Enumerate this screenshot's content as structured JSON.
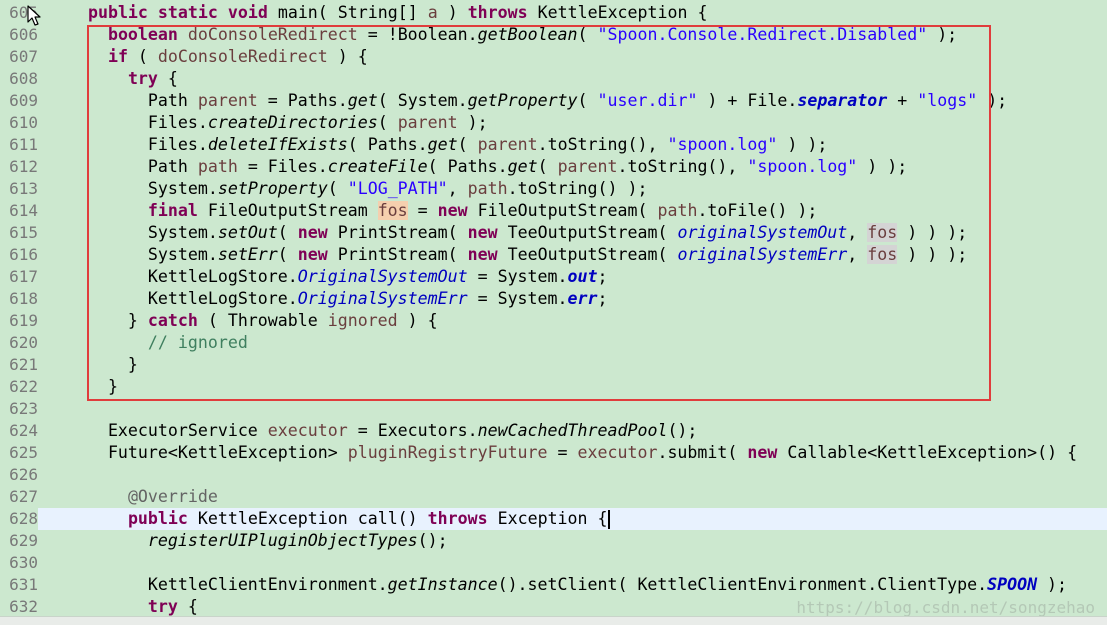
{
  "editor": {
    "lines": [
      {
        "n": "605",
        "tokens": [
          [
            "    ",
            ""
          ],
          [
            "public",
            "kw"
          ],
          [
            " ",
            ""
          ],
          [
            "static",
            "kw"
          ],
          [
            " ",
            ""
          ],
          [
            "void",
            "kw"
          ],
          [
            " main( String[] ",
            ""
          ],
          [
            "a",
            "var"
          ],
          [
            " ) ",
            ""
          ],
          [
            "throws",
            "kw"
          ],
          [
            " KettleException {",
            ""
          ]
        ]
      },
      {
        "n": "606",
        "tokens": [
          [
            "      ",
            ""
          ],
          [
            "boolean",
            "kw"
          ],
          [
            " ",
            ""
          ],
          [
            "doConsoleRedirect",
            "var"
          ],
          [
            " = !Boolean.",
            ""
          ],
          [
            "getBoolean",
            "it"
          ],
          [
            "( ",
            ""
          ],
          [
            "\"Spoon.Console.Redirect.Disabled\"",
            "str"
          ],
          [
            " );",
            ""
          ]
        ]
      },
      {
        "n": "607",
        "tokens": [
          [
            "      ",
            ""
          ],
          [
            "if",
            "kw"
          ],
          [
            " ( ",
            ""
          ],
          [
            "doConsoleRedirect",
            "var"
          ],
          [
            " ) {",
            ""
          ]
        ]
      },
      {
        "n": "608",
        "tokens": [
          [
            "        ",
            ""
          ],
          [
            "try",
            "kw"
          ],
          [
            " {",
            ""
          ]
        ]
      },
      {
        "n": "609",
        "tokens": [
          [
            "          Path ",
            ""
          ],
          [
            "parent",
            "var"
          ],
          [
            " = Paths.",
            ""
          ],
          [
            "get",
            "it"
          ],
          [
            "( System.",
            ""
          ],
          [
            "getProperty",
            "it"
          ],
          [
            "( ",
            ""
          ],
          [
            "\"user.dir\"",
            "str"
          ],
          [
            " ) + File.",
            ""
          ],
          [
            "separator",
            "fldb"
          ],
          [
            " + ",
            ""
          ],
          [
            "\"logs\"",
            "str"
          ],
          [
            " );",
            ""
          ]
        ]
      },
      {
        "n": "610",
        "tokens": [
          [
            "          Files.",
            ""
          ],
          [
            "createDirectories",
            "it"
          ],
          [
            "( ",
            ""
          ],
          [
            "parent",
            "var"
          ],
          [
            " );",
            ""
          ]
        ]
      },
      {
        "n": "611",
        "tokens": [
          [
            "          Files.",
            ""
          ],
          [
            "deleteIfExists",
            "it"
          ],
          [
            "( Paths.",
            ""
          ],
          [
            "get",
            "it"
          ],
          [
            "( ",
            ""
          ],
          [
            "parent",
            "var"
          ],
          [
            ".toString(), ",
            ""
          ],
          [
            "\"spoon.log\"",
            "str"
          ],
          [
            " ) );",
            ""
          ]
        ]
      },
      {
        "n": "612",
        "tokens": [
          [
            "          Path ",
            ""
          ],
          [
            "path",
            "var"
          ],
          [
            " = Files.",
            ""
          ],
          [
            "createFile",
            "it"
          ],
          [
            "( Paths.",
            ""
          ],
          [
            "get",
            "it"
          ],
          [
            "( ",
            ""
          ],
          [
            "parent",
            "var"
          ],
          [
            ".toString(), ",
            ""
          ],
          [
            "\"spoon.log\"",
            "str"
          ],
          [
            " ) );",
            ""
          ]
        ]
      },
      {
        "n": "613",
        "tokens": [
          [
            "          System.",
            ""
          ],
          [
            "setProperty",
            "it"
          ],
          [
            "( ",
            ""
          ],
          [
            "\"LOG_PATH\"",
            "str"
          ],
          [
            ", ",
            ""
          ],
          [
            "path",
            "var"
          ],
          [
            ".toString() );",
            ""
          ]
        ]
      },
      {
        "n": "614",
        "tokens": [
          [
            "          ",
            ""
          ],
          [
            "final",
            "kw"
          ],
          [
            " FileOutputStream ",
            ""
          ],
          [
            "fos",
            "var hl-occ"
          ],
          [
            " = ",
            ""
          ],
          [
            "new",
            "kw"
          ],
          [
            " FileOutputStream( ",
            ""
          ],
          [
            "path",
            "var"
          ],
          [
            ".toFile() );",
            ""
          ]
        ]
      },
      {
        "n": "615",
        "tokens": [
          [
            "          System.",
            ""
          ],
          [
            "setOut",
            "it"
          ],
          [
            "( ",
            ""
          ],
          [
            "new",
            "kw"
          ],
          [
            " PrintStream( ",
            ""
          ],
          [
            "new",
            "kw"
          ],
          [
            " TeeOutputStream( ",
            ""
          ],
          [
            "originalSystemOut",
            "fld"
          ],
          [
            ", ",
            ""
          ],
          [
            "fos",
            "var hl-read"
          ],
          [
            " ) ) );",
            ""
          ]
        ]
      },
      {
        "n": "616",
        "tokens": [
          [
            "          System.",
            ""
          ],
          [
            "setErr",
            "it"
          ],
          [
            "( ",
            ""
          ],
          [
            "new",
            "kw"
          ],
          [
            " PrintStream( ",
            ""
          ],
          [
            "new",
            "kw"
          ],
          [
            " TeeOutputStream( ",
            ""
          ],
          [
            "originalSystemErr",
            "fld"
          ],
          [
            ", ",
            ""
          ],
          [
            "fos",
            "var hl-read"
          ],
          [
            " ) ) );",
            ""
          ]
        ]
      },
      {
        "n": "617",
        "tokens": [
          [
            "          KettleLogStore.",
            ""
          ],
          [
            "OriginalSystemOut",
            "fld"
          ],
          [
            " = System.",
            ""
          ],
          [
            "out",
            "fldb"
          ],
          [
            ";",
            ""
          ]
        ]
      },
      {
        "n": "618",
        "tokens": [
          [
            "          KettleLogStore.",
            ""
          ],
          [
            "OriginalSystemErr",
            "fld"
          ],
          [
            " = System.",
            ""
          ],
          [
            "err",
            "fldb"
          ],
          [
            ";",
            ""
          ]
        ]
      },
      {
        "n": "619",
        "tokens": [
          [
            "        } ",
            ""
          ],
          [
            "catch",
            "kw"
          ],
          [
            " ( Throwable ",
            ""
          ],
          [
            "ignored",
            "var"
          ],
          [
            " ) {",
            ""
          ]
        ]
      },
      {
        "n": "620",
        "tokens": [
          [
            "          ",
            ""
          ],
          [
            "// ignored",
            "cm"
          ]
        ]
      },
      {
        "n": "621",
        "tokens": [
          [
            "        }",
            ""
          ]
        ]
      },
      {
        "n": "622",
        "tokens": [
          [
            "      }",
            ""
          ]
        ]
      },
      {
        "n": "623",
        "tokens": []
      },
      {
        "n": "624",
        "tokens": [
          [
            "      ExecutorService ",
            ""
          ],
          [
            "executor",
            "var"
          ],
          [
            " = Executors.",
            ""
          ],
          [
            "newCachedThreadPool",
            "it"
          ],
          [
            "();",
            ""
          ]
        ]
      },
      {
        "n": "625",
        "tokens": [
          [
            "      Future<KettleException> ",
            ""
          ],
          [
            "pluginRegistryFuture",
            "var"
          ],
          [
            " = ",
            ""
          ],
          [
            "executor",
            "var"
          ],
          [
            ".submit( ",
            ""
          ],
          [
            "new",
            "kw"
          ],
          [
            " Callable<KettleException>() {",
            ""
          ]
        ]
      },
      {
        "n": "626",
        "tokens": []
      },
      {
        "n": "627",
        "tokens": [
          [
            "        ",
            ""
          ],
          [
            "@Override",
            "ann"
          ]
        ]
      },
      {
        "n": "628",
        "current": true,
        "tokens": [
          [
            "        ",
            ""
          ],
          [
            "public",
            "kw"
          ],
          [
            " KettleException call() ",
            ""
          ],
          [
            "throws",
            "kw"
          ],
          [
            " Exception {",
            ""
          ]
        ]
      },
      {
        "n": "629",
        "tokens": [
          [
            "          ",
            ""
          ],
          [
            "registerUIPluginObjectTypes",
            "it"
          ],
          [
            "();",
            ""
          ]
        ]
      },
      {
        "n": "630",
        "tokens": []
      },
      {
        "n": "631",
        "tokens": [
          [
            "          KettleClientEnvironment.",
            ""
          ],
          [
            "getInstance",
            "it"
          ],
          [
            "().setClient( KettleClientEnvironment.ClientType.",
            ""
          ],
          [
            "SPOON",
            "fldb"
          ],
          [
            " );",
            ""
          ]
        ]
      },
      {
        "n": "632",
        "tokens": [
          [
            "          ",
            ""
          ],
          [
            "try",
            "kw"
          ],
          [
            " {",
            ""
          ]
        ]
      }
    ]
  },
  "watermark": "https://blog.csdn.net/songzehao",
  "colors": {
    "background": "#cce8cf",
    "keyword": "#7f0055",
    "string": "#2a00ff",
    "local_variable": "#6a3e3e",
    "field": "#0000c0",
    "comment": "#3f7f5f",
    "annotation": "#646464",
    "selection_box": "#e03c3c",
    "current_line": "#e8f2fe"
  },
  "icons": {
    "cursor": "mouse-pointer-icon",
    "collapse": "fold-collapse-icon"
  }
}
